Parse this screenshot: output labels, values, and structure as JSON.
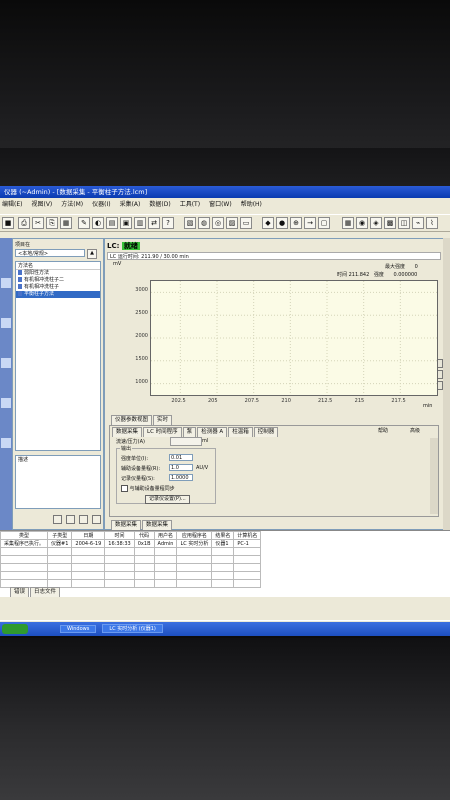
{
  "window": {
    "title": "仪器 (~Admin) - [数据采集 - 平衡柱子方法.lcm]"
  },
  "menu": {
    "items": [
      "编辑(E)",
      "视图(V)",
      "方法(M)",
      "仪器(I)",
      "采集(A)",
      "数据(D)",
      "工具(T)",
      "窗口(W)",
      "帮助(H)"
    ]
  },
  "project": {
    "label": "项目在",
    "selector_value": "<本地/常规>",
    "tree_header": "方法名",
    "methods": [
      "弱阳性方法",
      "有机相冲洗柱子二",
      "有机相冲洗柱子",
      "平衡柱子方法"
    ],
    "desc_label": "描述"
  },
  "status": {
    "lc_label": "LC:",
    "lc_state": "就绪",
    "run_time_text": "LC 运行时间: 211.90 / 30.00 min",
    "max_scale_label": "最大强度",
    "max_scale_value": "0",
    "readout_time": "时间 211.842",
    "readout_intensity_label": "强度",
    "readout_intensity_value": "0.000000"
  },
  "plot": {
    "y_unit": "mV",
    "x_unit": "min"
  },
  "chart_data": {
    "type": "line",
    "title": "",
    "ylabel": "mV",
    "xlabel": "min",
    "y_ticks": [
      1000,
      1500,
      2000,
      2500,
      3000
    ],
    "x_ticks": [
      202.5,
      205.0,
      207.5,
      210.0,
      212.5,
      215.0,
      217.5
    ],
    "xlim": [
      200.5,
      220.0
    ],
    "ylim": [
      750,
      3250
    ],
    "series": []
  },
  "bottom_panel": {
    "tabs": [
      "仪器参数视图",
      "实时"
    ],
    "subtabs": [
      "数据采集",
      "LC 时间程序",
      "泵",
      "检测器 A",
      "柱温箱",
      "控制器"
    ],
    "help_label": "帮助",
    "mode_label": "高级",
    "section_label": "标记",
    "field_rate_label": "流速/压力(A)",
    "field_rate_unit": "ml",
    "group_label": "输出",
    "out1_label": "强度单位(I):",
    "out1_value": "0.01",
    "out2_label": "辅助设备量程(R):",
    "out2_value": "1.0",
    "out2_unit": "AU/V",
    "out3_label": "记录仪量程(S):",
    "out3_value": "1.0000",
    "checkbox_label": "与辅助设备量程同步",
    "settings_button": "记录仪设置(P)..."
  },
  "view_tabs": [
    "数据采集",
    "数据采集"
  ],
  "log": {
    "columns": [
      "类型",
      "子类型",
      "日期",
      "时间",
      "代码",
      "用户名",
      "应用程序名",
      "结果名",
      "计算机名"
    ],
    "rows": [
      [
        "采集程序已执行。",
        "仪器#1",
        "2004-6-19",
        "16:38:33",
        "0x1B",
        "Admin",
        "LC 实时分析",
        "仪器1",
        "PC-1"
      ]
    ],
    "tabs": [
      "错误",
      "日志文件"
    ]
  },
  "taskbar": {
    "items": [
      "Windows",
      "LC 实时分析 (仪器1)"
    ]
  }
}
